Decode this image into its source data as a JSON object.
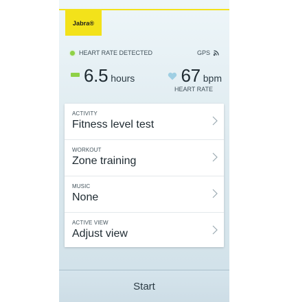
{
  "brand": {
    "logo_text": "Jabra®",
    "color": "#f3e21a"
  },
  "status": {
    "heart_rate_detected": "HEART RATE DETECTED",
    "gps_label": "GPS",
    "indicator_color": "#8fd147"
  },
  "metrics": {
    "duration_value": "6.5",
    "duration_unit": "hours",
    "heart_rate_value": "67",
    "heart_rate_unit": "bpm",
    "heart_rate_label": "HEART RATE"
  },
  "menu": {
    "items": [
      {
        "label": "ACTIVITY",
        "value": "Fitness level test"
      },
      {
        "label": "WORKOUT",
        "value": "Zone training"
      },
      {
        "label": "MUSIC",
        "value": "None"
      },
      {
        "label": "ACTIVE VIEW",
        "value": "Adjust view"
      }
    ]
  },
  "footer": {
    "start_label": "Start"
  }
}
